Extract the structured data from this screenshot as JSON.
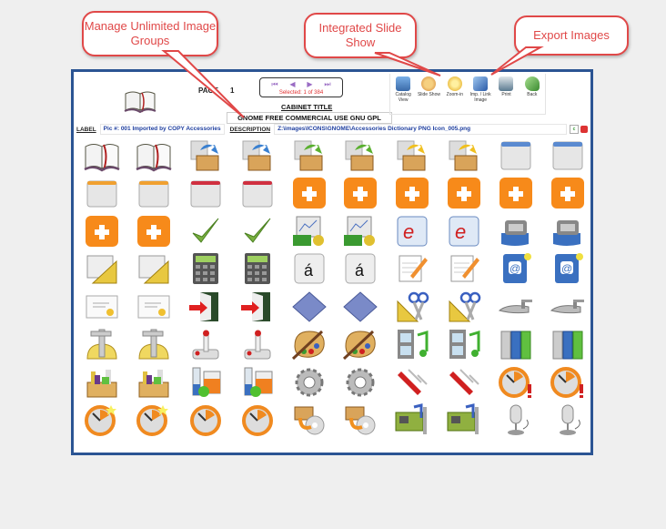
{
  "callouts": [
    {
      "text": "Manage Unlimited Image Groups"
    },
    {
      "text": "Integrated Slide Show"
    },
    {
      "text": "Export Images"
    }
  ],
  "header": {
    "page_label": "PAGE",
    "page_number": "1",
    "cabinet_title_label": "CABINET TITLE",
    "cabinet_title_value": "GNOME FREE COMMERCIAL USE GNU GPL"
  },
  "navigation": {
    "first": "⏮",
    "prev": "◀",
    "next": "▶",
    "last": "⏭",
    "selected_text": "Selected: 1 of 384"
  },
  "toolbar": [
    {
      "label": "Catalog View",
      "icon": "catalog-view-icon",
      "color": "#4a7fc0"
    },
    {
      "label": "Slide Show",
      "icon": "slide-show-icon",
      "color": "#e8a040"
    },
    {
      "label": "Zoom-in",
      "icon": "zoom-in-icon",
      "color": "#e8b020"
    },
    {
      "label": "Imp. / Link Image",
      "icon": "import-link-image-icon",
      "color": "#3a70c0"
    },
    {
      "label": "Print",
      "icon": "print-icon",
      "color": "#6a8aa0"
    },
    {
      "label": "Back",
      "icon": "back-icon",
      "color": "#5aa050"
    }
  ],
  "label_row": {
    "label_key": "LABEL",
    "label_value": "Pic #: 001  Imported by COPY Accessories",
    "description_key": "DESCRIPTION",
    "description_value": "Z:\\images\\ICONS\\GNOME\\Accessories Dictionary PNG Icon_005.png",
    "c_button": "c"
  },
  "grid_icons": [
    "dictionary",
    "dictionary",
    "package-blue-arrow",
    "package-blue-arrow",
    "package-green-arrow",
    "package-green-arrow",
    "package-yellow-arrow",
    "package-yellow-arrow",
    "window-blue",
    "window-blue",
    "window-orange",
    "window-orange",
    "window-red",
    "window-red",
    "add-orange",
    "add-orange",
    "add-orange",
    "add-orange",
    "add-orange",
    "add-orange",
    "add-orange",
    "add-orange",
    "checkmark",
    "checkmark",
    "finance-chart",
    "finance-chart",
    "e-document",
    "e-document",
    "scanner",
    "scanner",
    "blueprint",
    "blueprint",
    "calculator",
    "calculator",
    "character-key",
    "character-key",
    "notepad-pencil",
    "notepad-pencil",
    "address-book",
    "address-book",
    "certificate",
    "certificate",
    "exit-door",
    "exit-door",
    "diamond-graphic",
    "diamond-graphic",
    "cut-tools",
    "cut-tools",
    "trowel",
    "trowel",
    "caliper",
    "caliper",
    "joystick",
    "joystick",
    "paint-palette",
    "paint-palette",
    "multimedia",
    "multimedia",
    "binders",
    "binders",
    "toolbox",
    "toolbox",
    "science-beakers",
    "science-beakers",
    "gear",
    "gear",
    "swiss-knife",
    "swiss-knife",
    "clock-alert",
    "clock-alert",
    "clock-new",
    "clock-new",
    "clock",
    "clock",
    "package-cd",
    "package-cd",
    "sound-card",
    "sound-card",
    "microphone",
    "microphone"
  ]
}
